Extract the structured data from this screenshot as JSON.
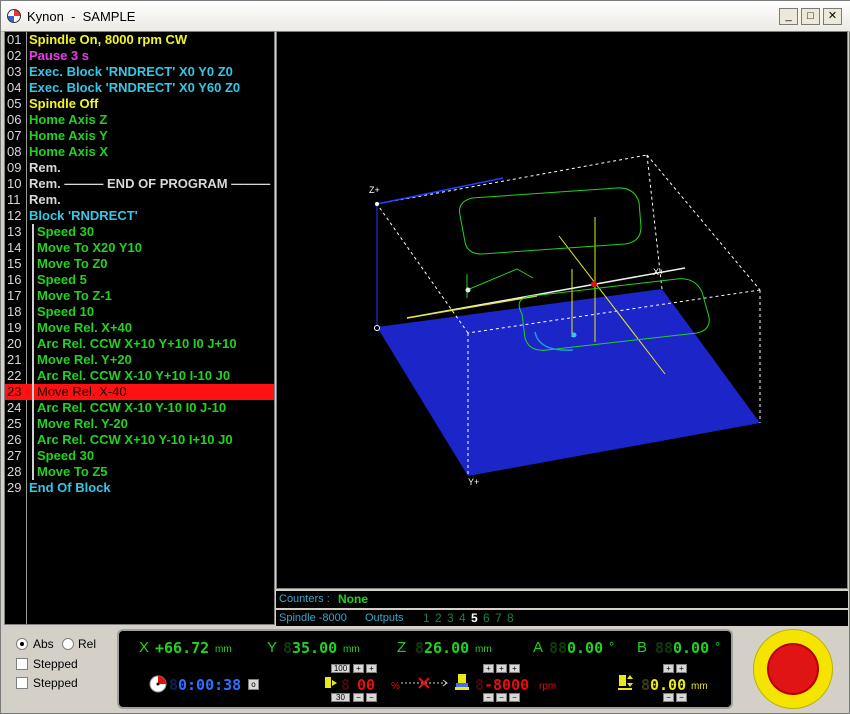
{
  "window": {
    "title": "Kynon  -  SAMPLE"
  },
  "program": {
    "lines": [
      {
        "num": "01",
        "text": "Spindle On, 8000 rpm CW",
        "color": "#f5f522",
        "indent": false
      },
      {
        "num": "02",
        "text": "Pause 3 s",
        "color": "#e83ee8",
        "indent": false
      },
      {
        "num": "03",
        "text": "Exec. Block 'RNDRECT' X0 Y0 Z0",
        "color": "#34c8e8",
        "indent": false
      },
      {
        "num": "04",
        "text": "Exec. Block 'RNDRECT' X0 Y60 Z0",
        "color": "#34c8e8",
        "indent": false
      },
      {
        "num": "05",
        "text": "Spindle Off",
        "color": "#f5f522",
        "indent": false
      },
      {
        "num": "06",
        "text": "Home Axis Z",
        "color": "#21d221",
        "indent": false
      },
      {
        "num": "07",
        "text": "Home Axis Y",
        "color": "#21d221",
        "indent": false
      },
      {
        "num": "08",
        "text": "Home Axis X",
        "color": "#21d221",
        "indent": false
      },
      {
        "num": "09",
        "text": "Rem.",
        "color": "#d8d8d8",
        "indent": false
      },
      {
        "num": "10",
        "text": "Rem. ——— END OF PROGRAM ———",
        "color": "#d8d8d8",
        "indent": false
      },
      {
        "num": "11",
        "text": "Rem.",
        "color": "#d8d8d8",
        "indent": false
      },
      {
        "num": "12",
        "text": "Block 'RNDRECT'",
        "color": "#34c8e8",
        "indent": false
      },
      {
        "num": "13",
        "text": "Speed 30",
        "color": "#21d221",
        "indent": true
      },
      {
        "num": "14",
        "text": "Move To X20 Y10",
        "color": "#21d221",
        "indent": true
      },
      {
        "num": "15",
        "text": "Move To Z0",
        "color": "#21d221",
        "indent": true
      },
      {
        "num": "16",
        "text": "Speed 5",
        "color": "#21d221",
        "indent": true
      },
      {
        "num": "17",
        "text": "Move To Z-1",
        "color": "#21d221",
        "indent": true
      },
      {
        "num": "18",
        "text": "Speed 10",
        "color": "#21d221",
        "indent": true
      },
      {
        "num": "19",
        "text": "Move Rel. X+40",
        "color": "#21d221",
        "indent": true
      },
      {
        "num": "20",
        "text": "Arc Rel. CCW X+10 Y+10 I0 J+10",
        "color": "#21d221",
        "indent": true
      },
      {
        "num": "21",
        "text": "Move Rel. Y+20",
        "color": "#21d221",
        "indent": true
      },
      {
        "num": "22",
        "text": "Arc Rel. CCW X-10 Y+10 I-10 J0",
        "color": "#21d221",
        "indent": true
      },
      {
        "num": "23",
        "text": "Move Rel. X-40",
        "color": "#1a0000",
        "indent": true,
        "selected": true
      },
      {
        "num": "24",
        "text": "Arc Rel. CCW X-10 Y-10 I0 J-10",
        "color": "#21d221",
        "indent": true
      },
      {
        "num": "25",
        "text": "Move Rel. Y-20",
        "color": "#21d221",
        "indent": true
      },
      {
        "num": "26",
        "text": "Arc Rel. CCW X+10 Y-10 I+10 J0",
        "color": "#21d221",
        "indent": true
      },
      {
        "num": "27",
        "text": "Speed 30",
        "color": "#21d221",
        "indent": true
      },
      {
        "num": "28",
        "text": "Move To Z5",
        "color": "#21d221",
        "indent": true
      },
      {
        "num": "29",
        "text": "End Of Block",
        "color": "#34c8e8",
        "indent": false
      }
    ]
  },
  "view3d": {
    "z_label": "Z+",
    "y_label": "Y+",
    "x_label": "X+"
  },
  "counters": {
    "label": "Counters :",
    "value": "None"
  },
  "status": {
    "spindle_label": "Spindle  -8000",
    "outputs_label": "Outputs",
    "outputs": [
      {
        "n": "1",
        "on": false
      },
      {
        "n": "2",
        "on": false
      },
      {
        "n": "3",
        "on": false
      },
      {
        "n": "4",
        "on": false
      },
      {
        "n": "5",
        "on": true
      },
      {
        "n": "6",
        "on": false
      },
      {
        "n": "7",
        "on": false
      },
      {
        "n": "8",
        "on": false
      }
    ]
  },
  "options": {
    "abs": "Abs",
    "rel": "Rel",
    "stepped1": "Stepped",
    "stepped2": "Stepped",
    "mode": "Abs"
  },
  "dro": {
    "x": {
      "label": "X",
      "ghost": "",
      "value": "+66.72",
      "unit": "mm"
    },
    "y": {
      "label": "Y",
      "ghost": "8",
      "value": "35.00",
      "unit": "mm"
    },
    "z": {
      "label": "Z",
      "ghost": "8",
      "value": "26.00",
      "unit": "mm"
    },
    "a": {
      "label": "A",
      "ghost": "88",
      "value": "0.00",
      "unit": "°"
    },
    "b": {
      "label": "B",
      "ghost": "88",
      "value": "0.00",
      "unit": "°"
    },
    "timer": {
      "ghost": "8",
      "value": "0:00:38",
      "btn": "o"
    },
    "feed": {
      "ghost": "8",
      "value": "00",
      "unit": "%",
      "top": "100",
      "bottom": "30"
    },
    "rpm": {
      "ghost": "8",
      "value": "-8000",
      "unit": "rpm"
    },
    "zsafe": {
      "ghost": "8",
      "value": "0.00",
      "unit": "mm"
    },
    "plus": "+",
    "minus": "−"
  }
}
